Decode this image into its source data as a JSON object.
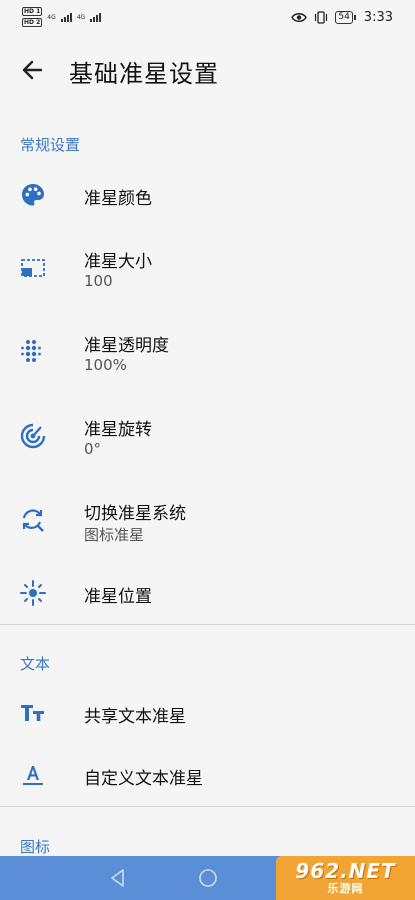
{
  "status_bar": {
    "sim1_label": "HD 1",
    "sim1_net": "4G",
    "sim2_label": "HD 2",
    "sim2_net": "4G",
    "battery": "54",
    "time": "3:33"
  },
  "header": {
    "title": "基础准星设置"
  },
  "sections": {
    "general": {
      "label": "常规设置",
      "items": [
        {
          "title": "准星颜色",
          "icon": "palette-icon"
        },
        {
          "title": "准星大小",
          "value": "100",
          "icon": "resize-icon"
        },
        {
          "title": "准星透明度",
          "value": "100%",
          "icon": "dots-grid-icon"
        },
        {
          "title": "准星旋转",
          "value": "0°",
          "icon": "rotate-icon"
        },
        {
          "title": "切换准星系统",
          "value": "图标准星",
          "icon": "switch-icon"
        },
        {
          "title": "准星位置",
          "icon": "position-icon"
        }
      ]
    },
    "text": {
      "label": "文本",
      "items": [
        {
          "title": "共享文本准星",
          "icon": "text-size-icon"
        },
        {
          "title": "自定义文本准星",
          "icon": "text-format-icon"
        }
      ]
    },
    "icon": {
      "label": "图标"
    }
  },
  "watermark": {
    "top": "962.NET",
    "bottom": "乐游网"
  },
  "colors": {
    "accent": "#3c78c2",
    "nav_bar": "#5a8fd8",
    "watermark": "#f2a534"
  }
}
